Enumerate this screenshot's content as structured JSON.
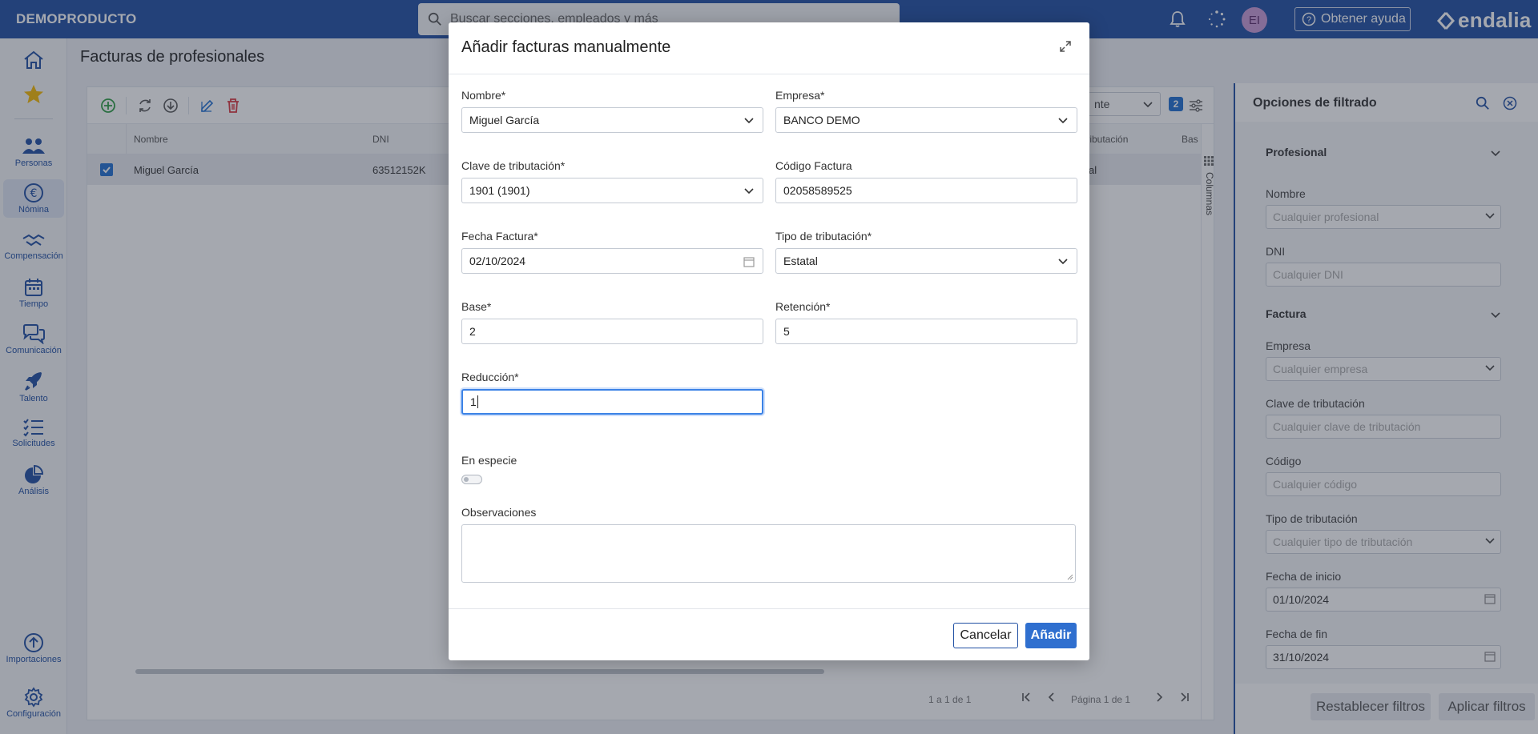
{
  "topbar": {
    "brand": "DEMOPRODUCTO",
    "search_placeholder": "Buscar secciones, empleados y más",
    "avatar_initials": "EI",
    "help_label": "Obtener ayuda",
    "logo_text": "endalia"
  },
  "nav": {
    "personas": "Personas",
    "nomina": "Nómina",
    "compensacion": "Compensación",
    "tiempo": "Tiempo",
    "comunicacion": "Comunicación",
    "talento": "Talento",
    "solicitudes": "Solicitudes",
    "analisis": "Análisis",
    "importaciones": "Importaciones",
    "configuracion": "Configuración"
  },
  "page": {
    "title": "Facturas de profesionales"
  },
  "grid": {
    "columns": {
      "nombre": "Nombre",
      "dni": "DNI",
      "tributacion": "e tributación",
      "base": "Bas"
    },
    "rows": [
      {
        "nombre": "Miguel García",
        "dni": "63512152K",
        "tributacion": "al"
      }
    ],
    "filter_select_value": "nte",
    "badge_count": "2",
    "columns_tab": "Columnas",
    "pager_count": "1 a 1 de 1",
    "pager_page": "Página 1 de 1"
  },
  "filters": {
    "title": "Opciones de filtrado",
    "section_profesional": "Profesional",
    "nombre_label": "Nombre",
    "nombre_placeholder": "Cualquier profesional",
    "dni_label": "DNI",
    "dni_placeholder": "Cualquier DNI",
    "section_factura": "Factura",
    "empresa_label": "Empresa",
    "empresa_placeholder": "Cualquier empresa",
    "clave_label": "Clave de tributación",
    "clave_placeholder": "Cualquier clave de tributación",
    "codigo_label": "Código",
    "codigo_placeholder": "Cualquier código",
    "tipo_label": "Tipo de tributación",
    "tipo_placeholder": "Cualquier tipo de tributación",
    "inicio_label": "Fecha de inicio",
    "inicio_value": "01/10/2024",
    "fin_label": "Fecha de fin",
    "fin_value": "31/10/2024",
    "reset_button": "Restablecer filtros",
    "apply_button": "Aplicar filtros"
  },
  "modal": {
    "title": "Añadir facturas manualmente",
    "nombre_label": "Nombre*",
    "nombre_value": "Miguel García",
    "empresa_label": "Empresa*",
    "empresa_value": "BANCO DEMO",
    "clave_label": "Clave de tributación*",
    "clave_value": "1901 (1901)",
    "codigo_label": "Código Factura",
    "codigo_value": "02058589525",
    "fecha_label": "Fecha Factura*",
    "fecha_value": "02/10/2024",
    "tipo_label": "Tipo de tributación*",
    "tipo_value": "Estatal",
    "base_label": "Base*",
    "base_value": "2",
    "retencion_label": "Retención*",
    "retencion_value": "5",
    "reduccion_label": "Reducción*",
    "reduccion_value": "1",
    "especie_label": "En especie",
    "observaciones_label": "Observaciones",
    "cancel_button": "Cancelar",
    "add_button": "Añadir"
  }
}
